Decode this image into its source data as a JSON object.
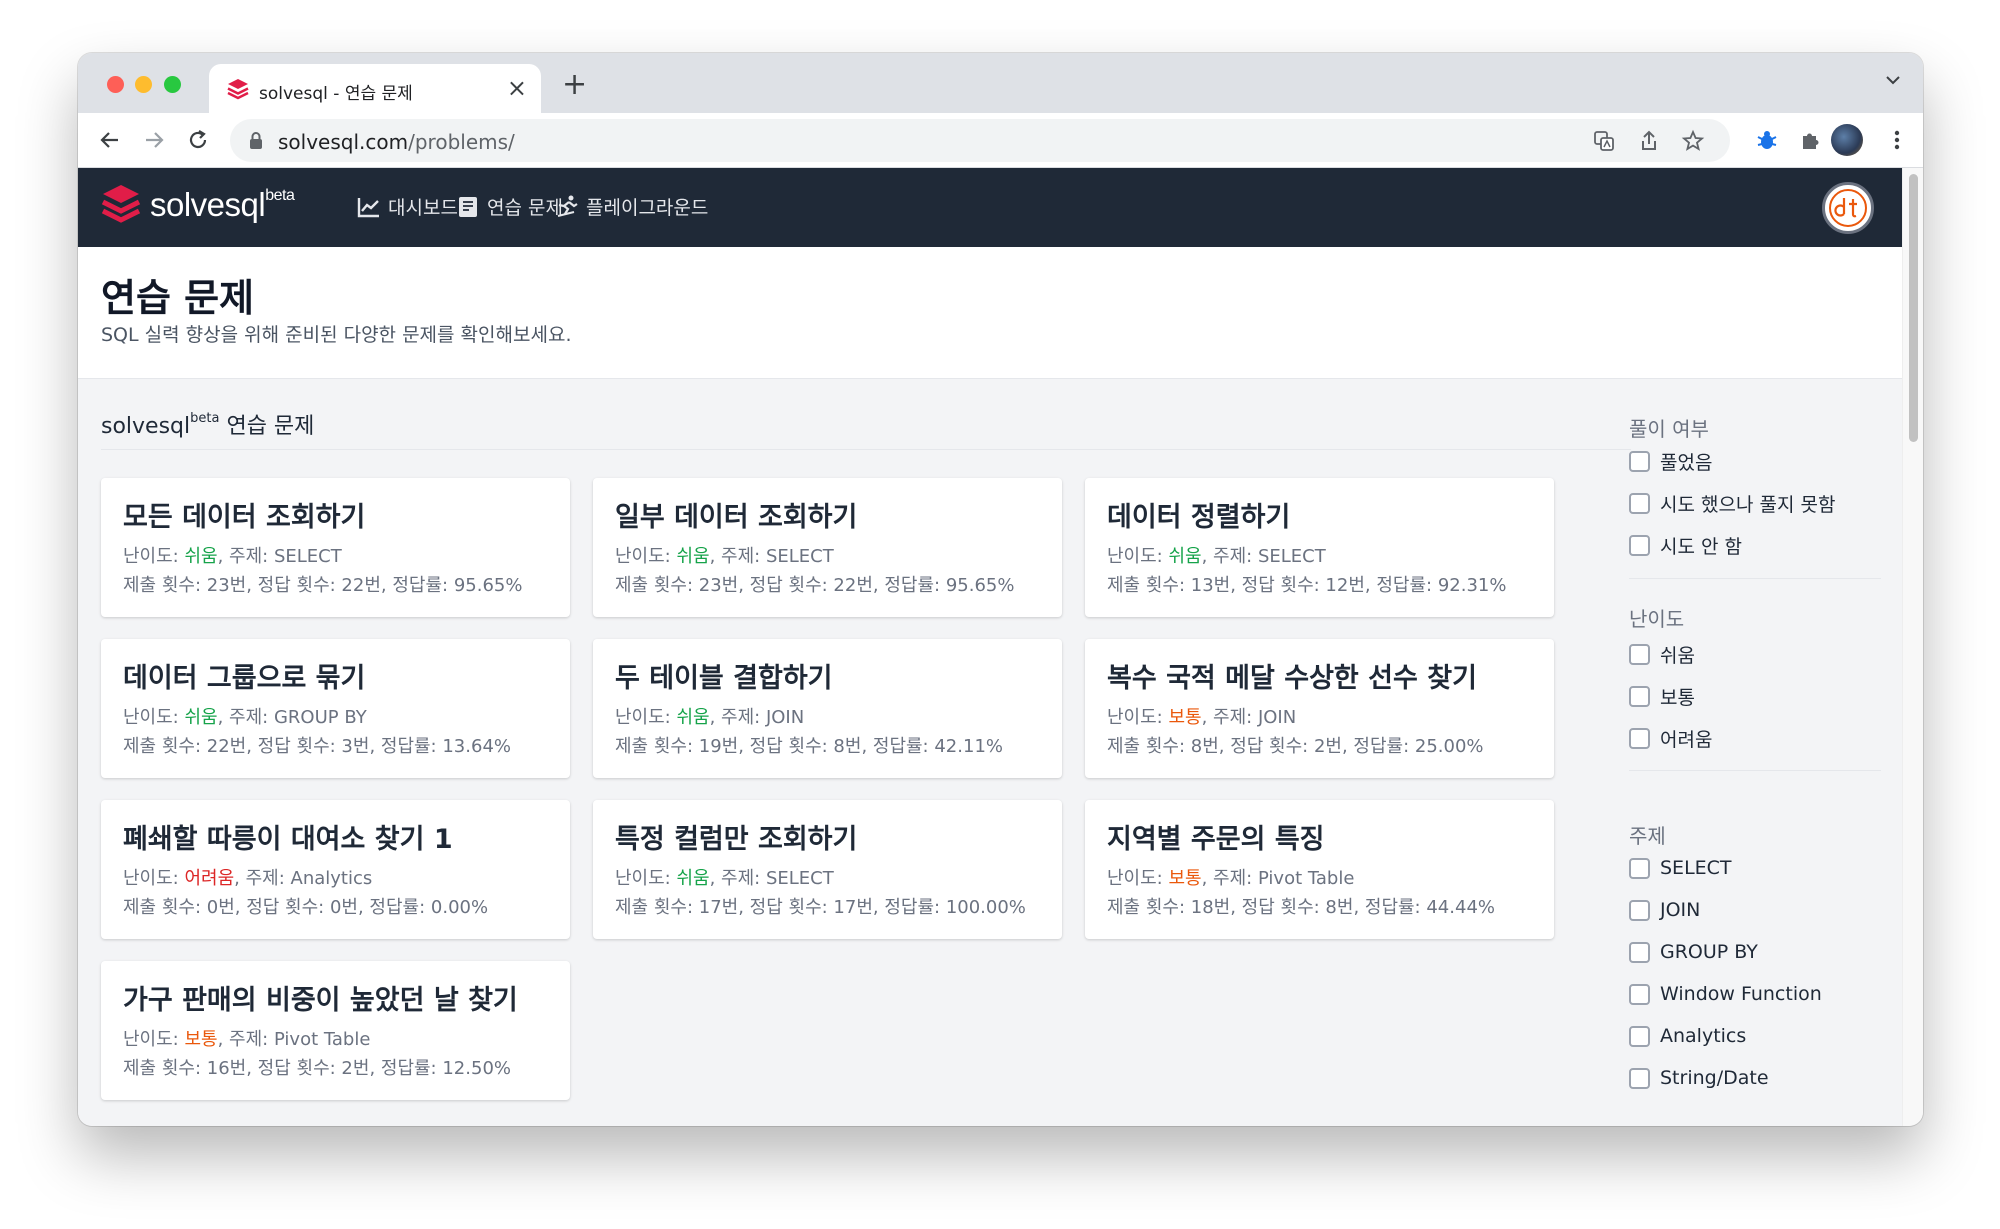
{
  "browser": {
    "tab_title": "solvesql - 연습 문제",
    "url_host": "solvesql.com",
    "url_path": "/problems/"
  },
  "app": {
    "logo_text": "solvesql",
    "logo_sup": "beta",
    "nav": [
      {
        "label": "대시보드",
        "icon": "chart-line-icon"
      },
      {
        "label": "연습 문제",
        "icon": "book-icon"
      },
      {
        "label": "플레이그라운드",
        "icon": "skater-icon"
      }
    ],
    "brand_color": "#e11d48"
  },
  "page": {
    "title": "연습 문제",
    "subtitle": "SQL 실력 향상을 위해 준비된 다양한 문제를 확인해보세요.",
    "section_prefix": "solvesql",
    "section_sup": "beta",
    "section_suffix": " 연습 문제"
  },
  "labels": {
    "difficulty": "난이도: ",
    "topic_sep": ", 주제: ",
    "submissions": "제출 횟수: ",
    "correct": ", 정답 횟수: ",
    "rate": ", 정답률: "
  },
  "problems": [
    {
      "title": "모든 데이터 조회하기",
      "level": "쉬움",
      "level_class": "easy",
      "topic": "SELECT",
      "submissions": "23번",
      "correct": "22번",
      "rate": "95.65%"
    },
    {
      "title": "일부 데이터 조회하기",
      "level": "쉬움",
      "level_class": "easy",
      "topic": "SELECT",
      "submissions": "23번",
      "correct": "22번",
      "rate": "95.65%"
    },
    {
      "title": "데이터 정렬하기",
      "level": "쉬움",
      "level_class": "easy",
      "topic": "SELECT",
      "submissions": "13번",
      "correct": "12번",
      "rate": "92.31%"
    },
    {
      "title": "데이터 그룹으로 묶기",
      "level": "쉬움",
      "level_class": "easy",
      "topic": "GROUP BY",
      "submissions": "22번",
      "correct": "3번",
      "rate": "13.64%"
    },
    {
      "title": "두 테이블 결합하기",
      "level": "쉬움",
      "level_class": "easy",
      "topic": "JOIN",
      "submissions": "19번",
      "correct": "8번",
      "rate": "42.11%"
    },
    {
      "title": "복수 국적 메달 수상한 선수 찾기",
      "level": "보통",
      "level_class": "mid",
      "topic": "JOIN",
      "submissions": "8번",
      "correct": "2번",
      "rate": "25.00%"
    },
    {
      "title": "폐쇄할 따릉이 대여소 찾기 1",
      "level": "어려움",
      "level_class": "hard",
      "topic": "Analytics",
      "submissions": "0번",
      "correct": "0번",
      "rate": "0.00%"
    },
    {
      "title": "특정 컬럼만 조회하기",
      "level": "쉬움",
      "level_class": "easy",
      "topic": "SELECT",
      "submissions": "17번",
      "correct": "17번",
      "rate": "100.00%"
    },
    {
      "title": "지역별 주문의 특징",
      "level": "보통",
      "level_class": "mid",
      "topic": "Pivot Table",
      "submissions": "18번",
      "correct": "8번",
      "rate": "44.44%"
    },
    {
      "title": "가구 판매의 비중이 높았던 날 찾기",
      "level": "보통",
      "level_class": "mid",
      "topic": "Pivot Table",
      "submissions": "16번",
      "correct": "2번",
      "rate": "12.50%"
    }
  ],
  "filters": {
    "solved": {
      "title": "풀이 여부",
      "options": [
        "풀었음",
        "시도 했으나 풀지 못함",
        "시도 안 함"
      ]
    },
    "difficulty": {
      "title": "난이도",
      "options": [
        "쉬움",
        "보통",
        "어려움"
      ]
    },
    "topic": {
      "title": "주제",
      "options": [
        "SELECT",
        "JOIN",
        "GROUP BY",
        "Window Function",
        "Analytics",
        "String/Date"
      ]
    }
  },
  "colors": {
    "easy": "#16a34a",
    "mid": "#ea580c",
    "hard": "#dc2626"
  }
}
